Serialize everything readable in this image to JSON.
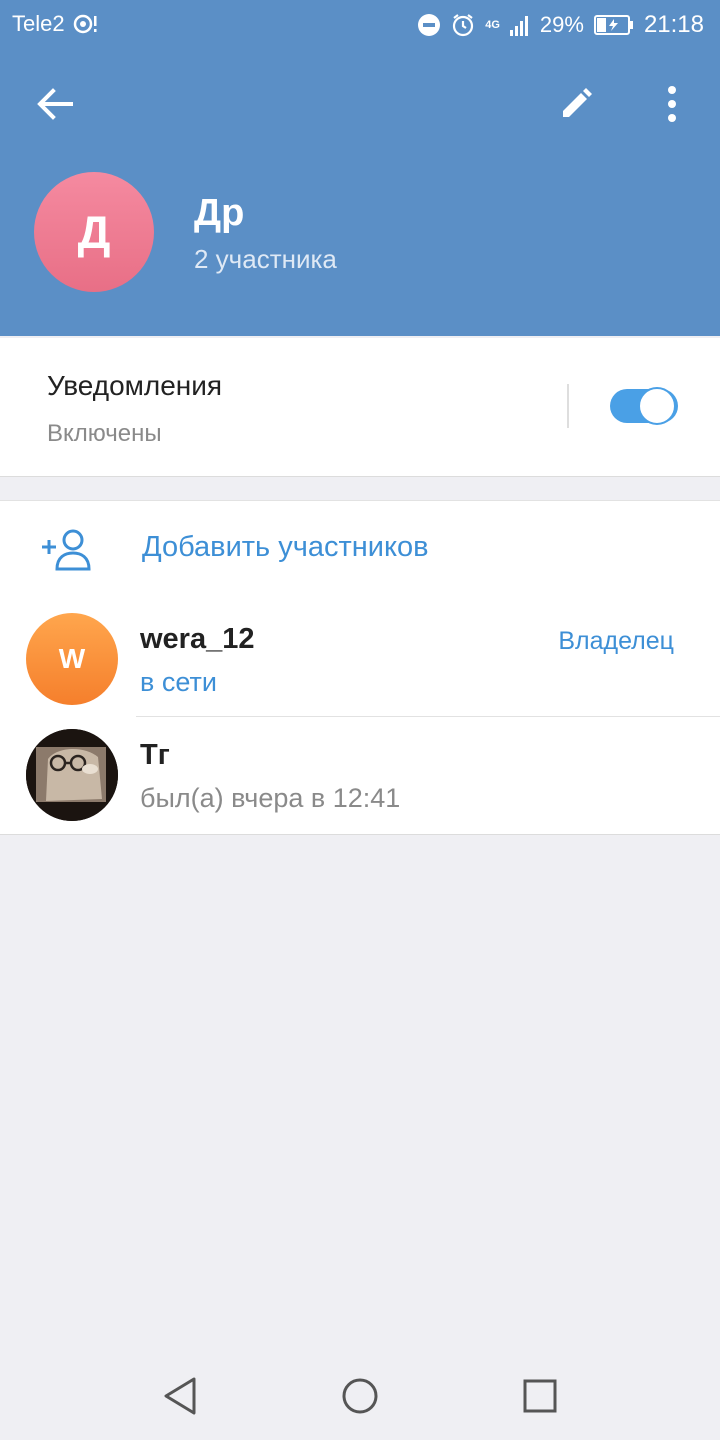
{
  "status_bar": {
    "carrier": "Tele2",
    "network": "4G",
    "battery": "29%",
    "time": "21:18"
  },
  "toolbar": {
    "back_icon": "arrow-left-icon",
    "edit_icon": "pencil-icon",
    "more_icon": "more-vertical-icon"
  },
  "group": {
    "avatar_letter": "Д",
    "title": "Др",
    "subtitle": "2 участника"
  },
  "notifications": {
    "title": "Уведомления",
    "subtitle": "Включены",
    "enabled": true
  },
  "members": {
    "add_label": "Добавить участников",
    "list": [
      {
        "avatar_letter": "W",
        "name": "wera_12",
        "status": "в сети",
        "role": "Владелец"
      },
      {
        "avatar_letter": "",
        "name": "Тг",
        "status": "был(а) вчера в 12:41",
        "role": ""
      }
    ]
  },
  "colors": {
    "header": "#5b8fc6",
    "accent": "#3d8fd6",
    "background": "#efeff3"
  }
}
